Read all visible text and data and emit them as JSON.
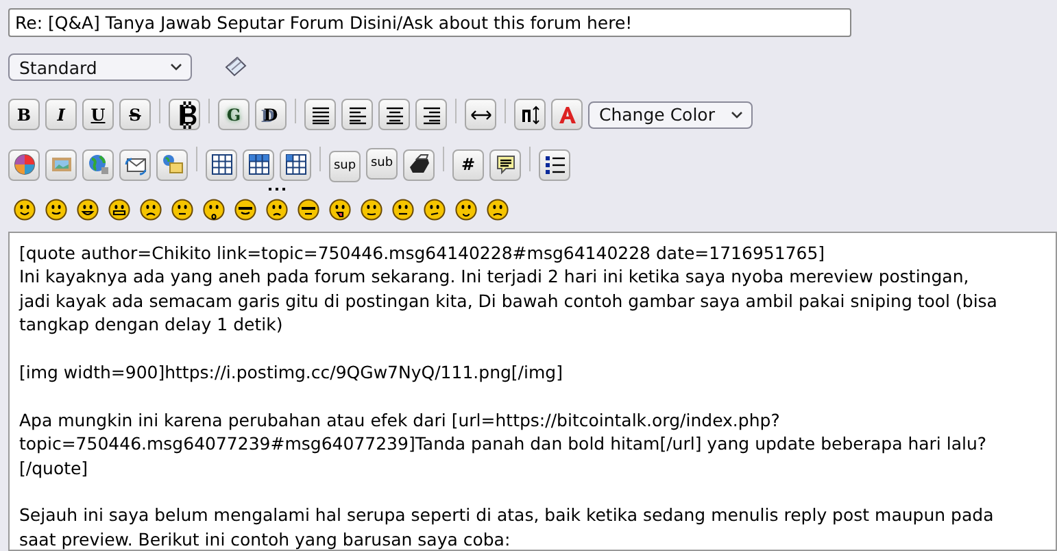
{
  "subject": {
    "value": "Re: [Q&A] Tanya Jawab Seputar Forum Disini/Ask about this forum here!"
  },
  "font_select": {
    "value": "Standard"
  },
  "toolbar_rows": [
    [
      [
        {
          "kind": "text",
          "label": "B"
        },
        {
          "kind": "text",
          "label": "I"
        },
        {
          "kind": "text",
          "label": "U"
        },
        {
          "kind": "text",
          "label": "S"
        }
      ],
      [
        {
          "kind": "icon"
        }
      ],
      [
        {
          "kind": "text",
          "label": "G"
        },
        {
          "kind": "text",
          "label": "D"
        }
      ],
      [
        {
          "kind": "icon"
        },
        {
          "kind": "icon"
        },
        {
          "kind": "icon"
        },
        {
          "kind": "icon"
        }
      ],
      [
        {
          "kind": "icon"
        }
      ],
      [
        {
          "kind": "icon"
        },
        {
          "kind": "icon"
        }
      ]
    ],
    [
      [
        {
          "kind": "icon"
        },
        {
          "kind": "icon"
        },
        {
          "kind": "icon"
        },
        {
          "kind": "icon"
        },
        {
          "kind": "icon"
        }
      ],
      [
        {
          "kind": "icon"
        },
        {
          "kind": "icon"
        },
        {
          "kind": "icon"
        }
      ],
      [
        {
          "kind": "text",
          "label": "sup"
        },
        {
          "kind": "text",
          "label": "sub"
        },
        {
          "kind": "icon"
        }
      ],
      [
        {
          "kind": "text",
          "label": "#"
        },
        {
          "kind": "icon"
        }
      ],
      [
        {
          "kind": "icon"
        }
      ]
    ]
  ],
  "color_select": {
    "value": "Change Color"
  },
  "message": "[quote author=Chikito link=topic=750446.msg64140228#msg64140228 date=1716951765]\nIni kayaknya ada yang aneh pada forum sekarang. Ini terjadi 2 hari ini ketika saya nyoba mereview postingan,\njadi kayak ada semacam garis gitu di postingan kita, Di bawah contoh gambar saya ambil pakai sniping tool (bisa\ntangkap dengan delay 1 detik)\n\n[img width=900]https://i.postimg.cc/9QGw7NyQ/111.png[/img]\n\nApa mungkin ini karena perubahan atau efek dari [url=https://bitcointalk.org/index.php?\ntopic=750446.msg64077239#msg64077239]Tanda panah dan bold hitam[/url] yang update beberapa hari lalu?\n[/quote]\n\nSejauh ini saya belum mengalami hal serupa seperti di atas, baik ketika sedang menulis reply post maupun pada\nsaat preview. Berikut ini contoh yang barusan saya coba:"
}
